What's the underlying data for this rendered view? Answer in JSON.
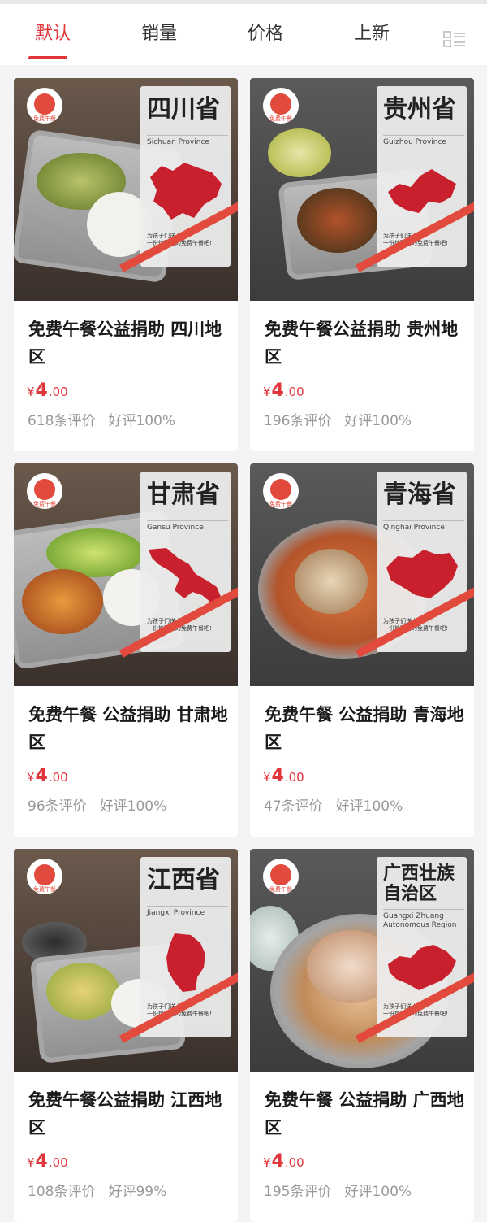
{
  "tabs": [
    {
      "label": "默认",
      "active": true
    },
    {
      "label": "销量",
      "active": false
    },
    {
      "label": "价格",
      "active": false
    },
    {
      "label": "上新",
      "active": false
    }
  ],
  "layout_toggle_icon": "list-view-icon",
  "colors": {
    "accent": "#e0353b",
    "muted": "#999999",
    "brand_red": "#e14a3c"
  },
  "products": [
    {
      "province": "四川省",
      "province_en": "Sichuan Province",
      "slogan": "为孩子们送上\n一份热腾腾的免费午餐吧!",
      "logo_text": "免费午餐",
      "title": "免费午餐公益捐助 四川地区",
      "currency": "¥",
      "price_int": "4",
      "price_dec": ".00",
      "reviews": "618条评价",
      "rating": "好评100%"
    },
    {
      "province": "贵州省",
      "province_en": "Guizhou Province",
      "slogan": "为孩子们送上\n一份热腾腾的免费午餐吧!",
      "logo_text": "免费午餐",
      "title": "免费午餐公益捐助 贵州地区",
      "currency": "¥",
      "price_int": "4",
      "price_dec": ".00",
      "reviews": "196条评价",
      "rating": "好评100%"
    },
    {
      "province": "甘肃省",
      "province_en": "Gansu Province",
      "slogan": "为孩子们送上\n一份热腾腾的免费午餐吧!",
      "logo_text": "免费午餐",
      "title": "免费午餐 公益捐助 甘肃地区",
      "currency": "¥",
      "price_int": "4",
      "price_dec": ".00",
      "reviews": "96条评价",
      "rating": "好评100%"
    },
    {
      "province": "青海省",
      "province_en": "Qinghai Province",
      "slogan": "为孩子们送上\n一份热腾腾的免费午餐吧!",
      "logo_text": "免费午餐",
      "title": "免费午餐 公益捐助 青海地区",
      "currency": "¥",
      "price_int": "4",
      "price_dec": ".00",
      "reviews": "47条评价",
      "rating": "好评100%"
    },
    {
      "province": "江西省",
      "province_en": "Jiangxi Province",
      "slogan": "为孩子们送上\n一份热腾腾的免费午餐吧!",
      "logo_text": "免费午餐",
      "title": "免费午餐公益捐助 江西地区",
      "currency": "¥",
      "price_int": "4",
      "price_dec": ".00",
      "reviews": "108条评价",
      "rating": "好评99%"
    },
    {
      "province": "广西壮族自治区",
      "province_en": "Guangxi Zhuang Autonomous Region",
      "slogan": "为孩子们送上\n一份热腾腾的免费午餐吧!",
      "logo_text": "免费午餐",
      "title": "免费午餐 公益捐助 广西地区",
      "currency": "¥",
      "price_int": "4",
      "price_dec": ".00",
      "reviews": "195条评价",
      "rating": "好评100%"
    }
  ]
}
